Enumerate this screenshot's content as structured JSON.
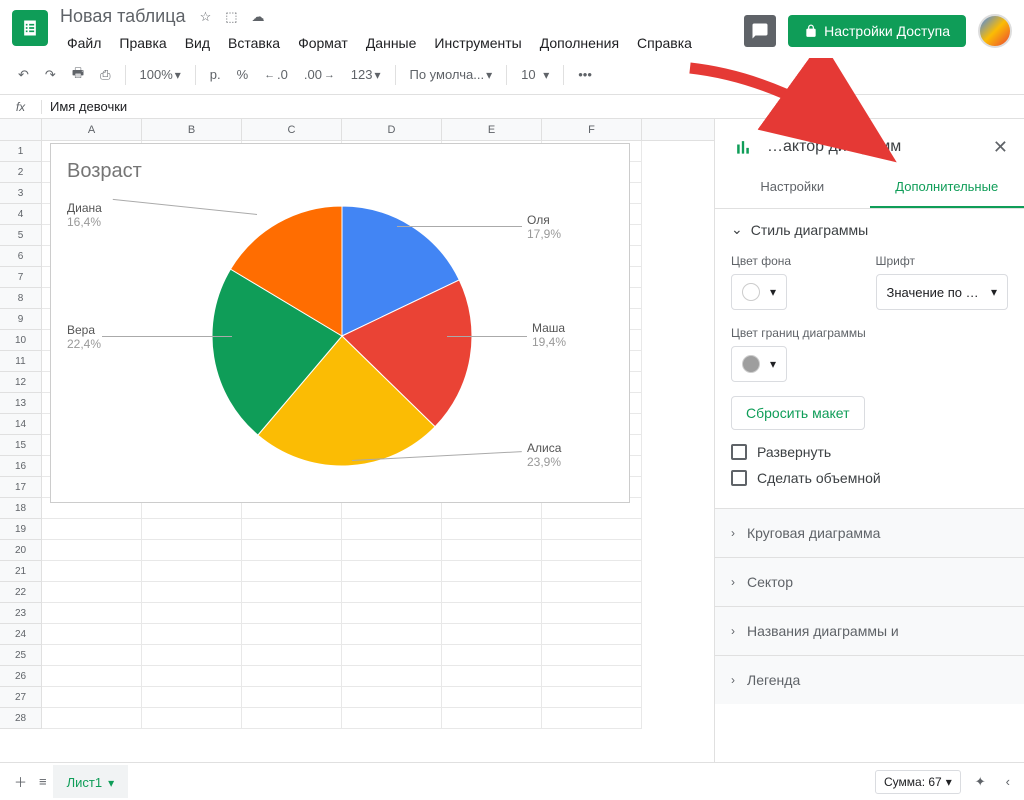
{
  "doc": {
    "title": "Новая таблица"
  },
  "menu": {
    "file": "Файл",
    "edit": "Правка",
    "view": "Вид",
    "insert": "Вставка",
    "format": "Формат",
    "data": "Данные",
    "tools": "Инструменты",
    "addons": "Дополнения",
    "help": "Справка"
  },
  "share": {
    "label": "Настройки Доступа"
  },
  "toolbar": {
    "zoom": "100%",
    "currency": "р.",
    "percent": "%",
    "dec_dec": ".0",
    "dec_inc": ".00",
    "num": "123",
    "font": "По умолча...",
    "size": "10",
    "more": "•••"
  },
  "fx": {
    "value": "Имя девочки"
  },
  "columns": [
    "A",
    "B",
    "C",
    "D",
    "E",
    "F"
  ],
  "chart_data": {
    "type": "pie",
    "title": "Возраст",
    "series": [
      {
        "name": "Оля",
        "value": 17.9,
        "label": "17,9%",
        "color": "#4285f4"
      },
      {
        "name": "Маша",
        "value": 19.4,
        "label": "19,4%",
        "color": "#ea4335"
      },
      {
        "name": "Алиса",
        "value": 23.9,
        "label": "23,9%",
        "color": "#fbbc04"
      },
      {
        "name": "Вера",
        "value": 22.4,
        "label": "22,4%",
        "color": "#0f9d58"
      },
      {
        "name": "Диана",
        "value": 16.4,
        "label": "16,4%",
        "color": "#ff6d01"
      }
    ]
  },
  "panel": {
    "title": "…актор диаграмм",
    "tab_setup": "Настройки",
    "tab_customize": "Дополнительные",
    "style": {
      "heading": "Стиль диаграммы",
      "bg_label": "Цвет фона",
      "font_label": "Шрифт",
      "font_value": "Значение по …",
      "border_label": "Цвет границ диаграммы",
      "reset": "Сбросить макет",
      "maximize": "Развернуть",
      "threeD": "Сделать объемной"
    },
    "sections": {
      "pie": "Круговая диаграмма",
      "slice": "Сектор",
      "titles": "Названия диаграммы и",
      "legend": "Легенда"
    }
  },
  "bottom": {
    "sheet": "Лист1",
    "sum": "Сумма: 67"
  }
}
